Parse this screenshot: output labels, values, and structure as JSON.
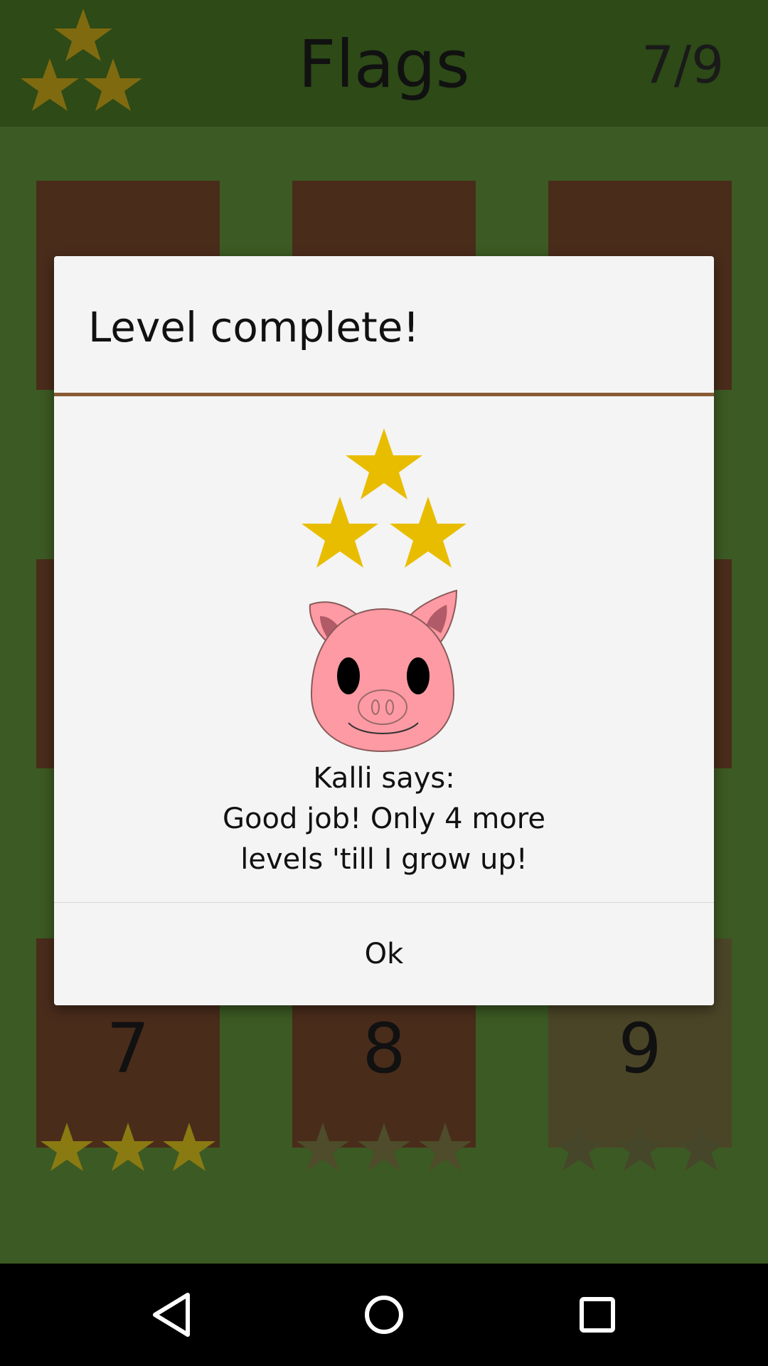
{
  "header": {
    "title": "Flags",
    "progress": "7/9"
  },
  "levels": [
    {
      "number": "7",
      "stars_earned": 3,
      "locked": false
    },
    {
      "number": "8",
      "stars_earned": 0,
      "locked": false
    },
    {
      "number": "9",
      "stars_earned": 0,
      "locked": true
    }
  ],
  "dialog": {
    "title": "Level complete!",
    "stars_earned": 3,
    "message_lines": [
      "Kalli says:",
      "Good job! Only 4 more",
      "levels 'till I grow up!"
    ],
    "ok_label": "Ok"
  },
  "colors": {
    "background": "#3c5a23",
    "header": "#2d4a17",
    "tile": "#4a2c1b",
    "tile_locked": "#4b4528",
    "star_gold": "#e8bd00",
    "star_dim_header": "#7f6a10",
    "star_earned_tile": "#8a7a12",
    "star_empty_tile": "#4e4c2a",
    "dialog_bg": "#f4f4f4",
    "dialog_divider": "#8a5a35",
    "pig": "#fd9aa3"
  },
  "navigation": {
    "back": "back-icon",
    "home": "home-icon",
    "recents": "recents-icon"
  }
}
